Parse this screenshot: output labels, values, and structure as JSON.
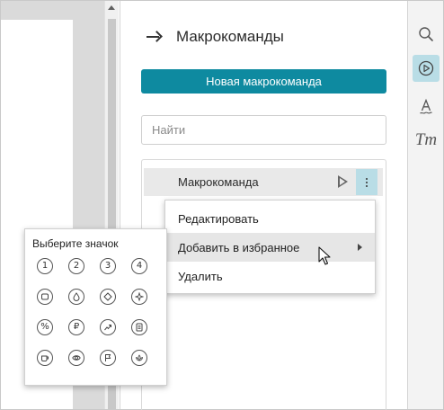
{
  "panel": {
    "title": "Макрокоманды",
    "new_button_label": "Новая макрокоманда",
    "search_placeholder": "Найти"
  },
  "macros": [
    {
      "name": "Макрокоманда"
    }
  ],
  "context_menu": {
    "items": [
      {
        "label": "Редактировать"
      },
      {
        "label": "Добавить в избранное"
      },
      {
        "label": "Удалить"
      }
    ]
  },
  "icon_picker": {
    "title": "Выберите значок",
    "icons": [
      {
        "label": "1",
        "name": "number-1-icon"
      },
      {
        "label": "2",
        "name": "number-2-icon"
      },
      {
        "label": "3",
        "name": "number-3-icon"
      },
      {
        "label": "4",
        "name": "number-4-icon"
      },
      {
        "label": "",
        "name": "square-icon"
      },
      {
        "label": "",
        "name": "drop-icon"
      },
      {
        "label": "",
        "name": "diamond-icon"
      },
      {
        "label": "",
        "name": "sparkle-icon"
      },
      {
        "label": "%",
        "name": "percent-icon"
      },
      {
        "label": "₽",
        "name": "ruble-icon"
      },
      {
        "label": "",
        "name": "chart-arrow-icon"
      },
      {
        "label": "",
        "name": "document-icon"
      },
      {
        "label": "",
        "name": "cup-icon"
      },
      {
        "label": "",
        "name": "eye-icon"
      },
      {
        "label": "",
        "name": "flag-icon"
      },
      {
        "label": "",
        "name": "lotus-icon"
      }
    ]
  },
  "toolbar": {
    "tools": [
      {
        "name": "search-tool-icon"
      },
      {
        "name": "macro-play-tool-icon"
      },
      {
        "name": "text-style-tool-icon"
      },
      {
        "name": "font-tool-icon"
      }
    ]
  },
  "colors": {
    "accent": "#0e8aa0",
    "active_bg": "#b9dde6"
  }
}
